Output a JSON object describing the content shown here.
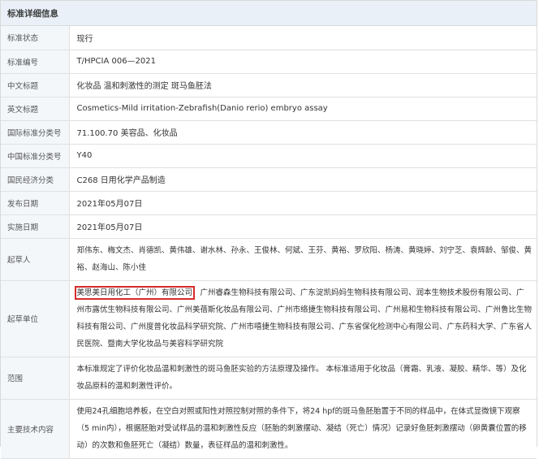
{
  "header": {
    "title": "标准详细信息"
  },
  "rows": {
    "status": {
      "label": "标准状态",
      "value": "现行"
    },
    "number": {
      "label": "标准编号",
      "value": "T/HPCIA 006—2021"
    },
    "cn_title": {
      "label": "中文标题",
      "value": "化妆品 温和刺激性的测定 斑马鱼胚法"
    },
    "en_title": {
      "label": "英文标题",
      "value": "Cosmetics-Mild irritation-Zebrafish(Danio rerio) embryo assay"
    },
    "intl_class": {
      "label": "国际标准分类号",
      "value": "71.100.70 美容品、化妆品"
    },
    "cn_class": {
      "label": "中国标准分类号",
      "value": "Y40"
    },
    "econ_class": {
      "label": "国民经济分类",
      "value": "C268 日用化学产品制造"
    },
    "publish": {
      "label": "发布日期",
      "value": "2021年05月07日"
    },
    "implement": {
      "label": "实施日期",
      "value": "2021年05月07日"
    },
    "drafters": {
      "label": "起草人",
      "value": "郑伟东、梅文杰、肖德凯、黄伟雄、谢水林、孙永、王俊林、何斌、王芬、黄裕、罗欣阳、杨涛、黄晓婷、刘宁芝、袁辉龄、邹俊、黄裕、赵海山、陈小佳"
    },
    "units": {
      "label": "起草单位",
      "highlight": "美思美日用化工（广州）有限公司",
      "value": "、广州睿森生物科技有限公司、广东淀凯妈妈生物科技有限公司、润本生物技术股份有限公司、广州市露优生物科技有限公司、广州美蓓斯化妆品有限公司、广州市络捷生物科技有限公司、广州易和生物科技有限公司、广州鲁比生物科技有限公司、广州度普化妆品科学研究院、广州市嘻捷生物科技有限公司、广东省保化检测中心有限公司、广东药科大学、广东省人民医院、暨南大学化妆品与美容科学研究院"
    },
    "scope": {
      "label": "范围",
      "value": "本标准规定了评价化妆品温和刺激性的斑马鱼胚实验的方法原理及操作。 本标准适用于化妆品（膏霜、乳液、凝胶、精华、等）及化妆品原料的温和刺激性评价。"
    },
    "tech": {
      "label": "主要技术内容",
      "value": "使用24孔细胞培养板，在空白对照或阳性对照控制对照的条件下，将24 hpf的斑马鱼胚胎置于不同的样品中，在体式显微镜下观察（5 min内），根据胚胎对受试样品的温和刺激性反应（胚胎的刺激摆动、凝结（死亡）情况）记录好鱼胚刺激摆动（卵黄囊位置的移动）的次数和鱼胚死亡（凝结）数量，表征样品的温和刺激性。"
    }
  }
}
